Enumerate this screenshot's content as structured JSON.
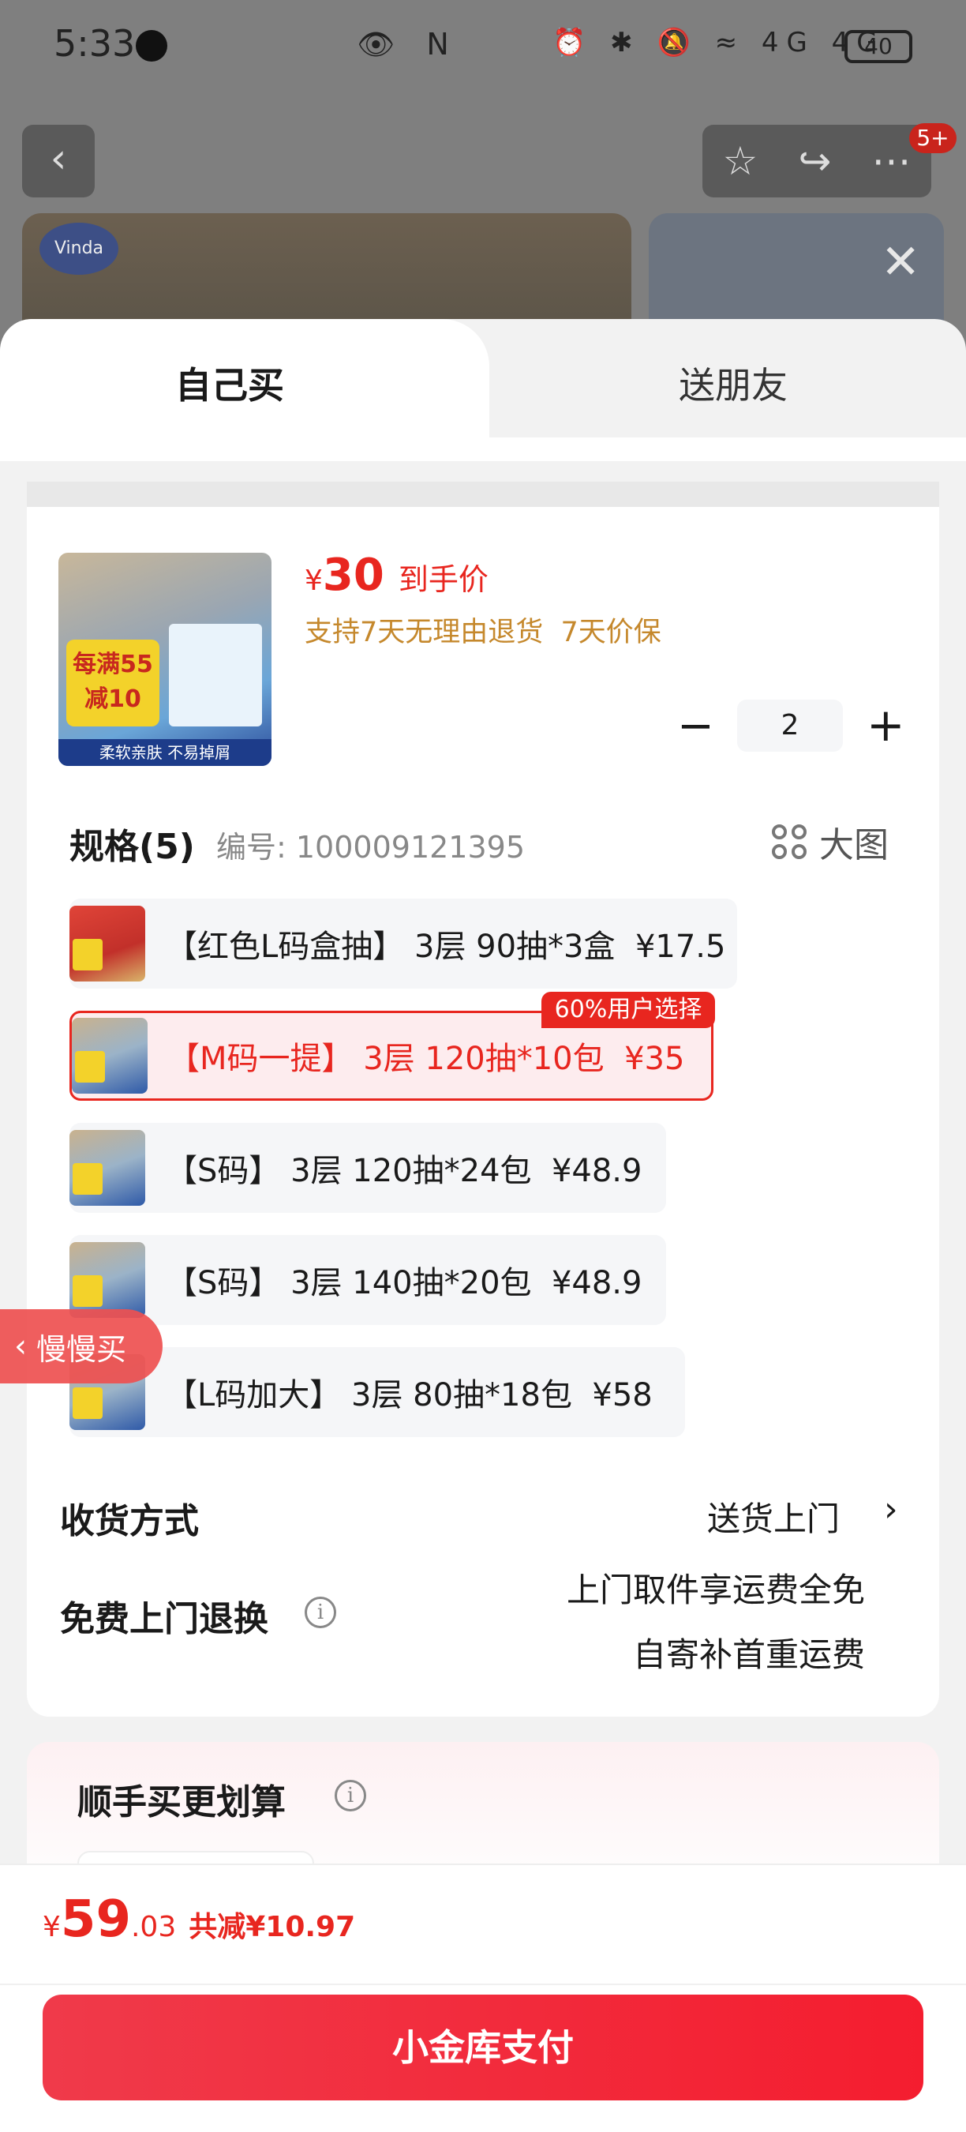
{
  "status_bar": {
    "time": "5:33",
    "battery": "40",
    "center_icons": "👁 N",
    "right_icons": "⏰ ✱ 🔕 ≈ 4G 4G"
  },
  "background": {
    "back_icon": "‹",
    "toolbar_icons": [
      "☆",
      "↪",
      "⋯"
    ],
    "notification_badge": "5+",
    "brand_logo": "Vinda",
    "close_icon": "✕"
  },
  "tabs": {
    "self_buy": "自己买",
    "gift_friend": "送朋友"
  },
  "product": {
    "price_currency": "¥",
    "price_value": "30",
    "price_tag": "到手价",
    "guarantee": "支持7天无理由退货  7天价保",
    "thumb_sale_text": "每满55\n减10",
    "thumb_band_text": "柔软亲肤 不易掉屑"
  },
  "quantity": {
    "minus": "−",
    "value": "2",
    "plus": "+"
  },
  "spec": {
    "title": "规格(5)",
    "id_text": "编号: 100009121395",
    "big_picture": "大图",
    "popular_badge": "60%用户选择",
    "options": [
      {
        "label": "【红色L码盒抽】 3层 90抽*3盒  ¥17.5",
        "selected": false
      },
      {
        "label": "【M码一提】 3层 120抽*10包  ¥35",
        "selected": true
      },
      {
        "label": "【S码】 3层 120抽*24包  ¥48.9",
        "selected": false
      },
      {
        "label": "【S码】 3层 140抽*20包  ¥48.9",
        "selected": false
      },
      {
        "label": "【L码加大】 3层 80抽*18包  ¥58",
        "selected": false
      }
    ]
  },
  "delivery": {
    "label": "收货方式",
    "value": "送货上门",
    "arrow": "›"
  },
  "free_return": {
    "label": "免费上门退换",
    "info_icon": "i",
    "line1": "上门取件享运费全免",
    "line2": "自寄补首重运费"
  },
  "addon": {
    "title": "顺手买更划算",
    "info_icon": "i"
  },
  "slow_buy": {
    "chevron": "‹",
    "label": "慢慢买"
  },
  "checkout": {
    "currency": "¥",
    "total_int": "59",
    "total_dec": ".03",
    "savings": "共减¥10.97",
    "pay_button": "小金库支付"
  }
}
